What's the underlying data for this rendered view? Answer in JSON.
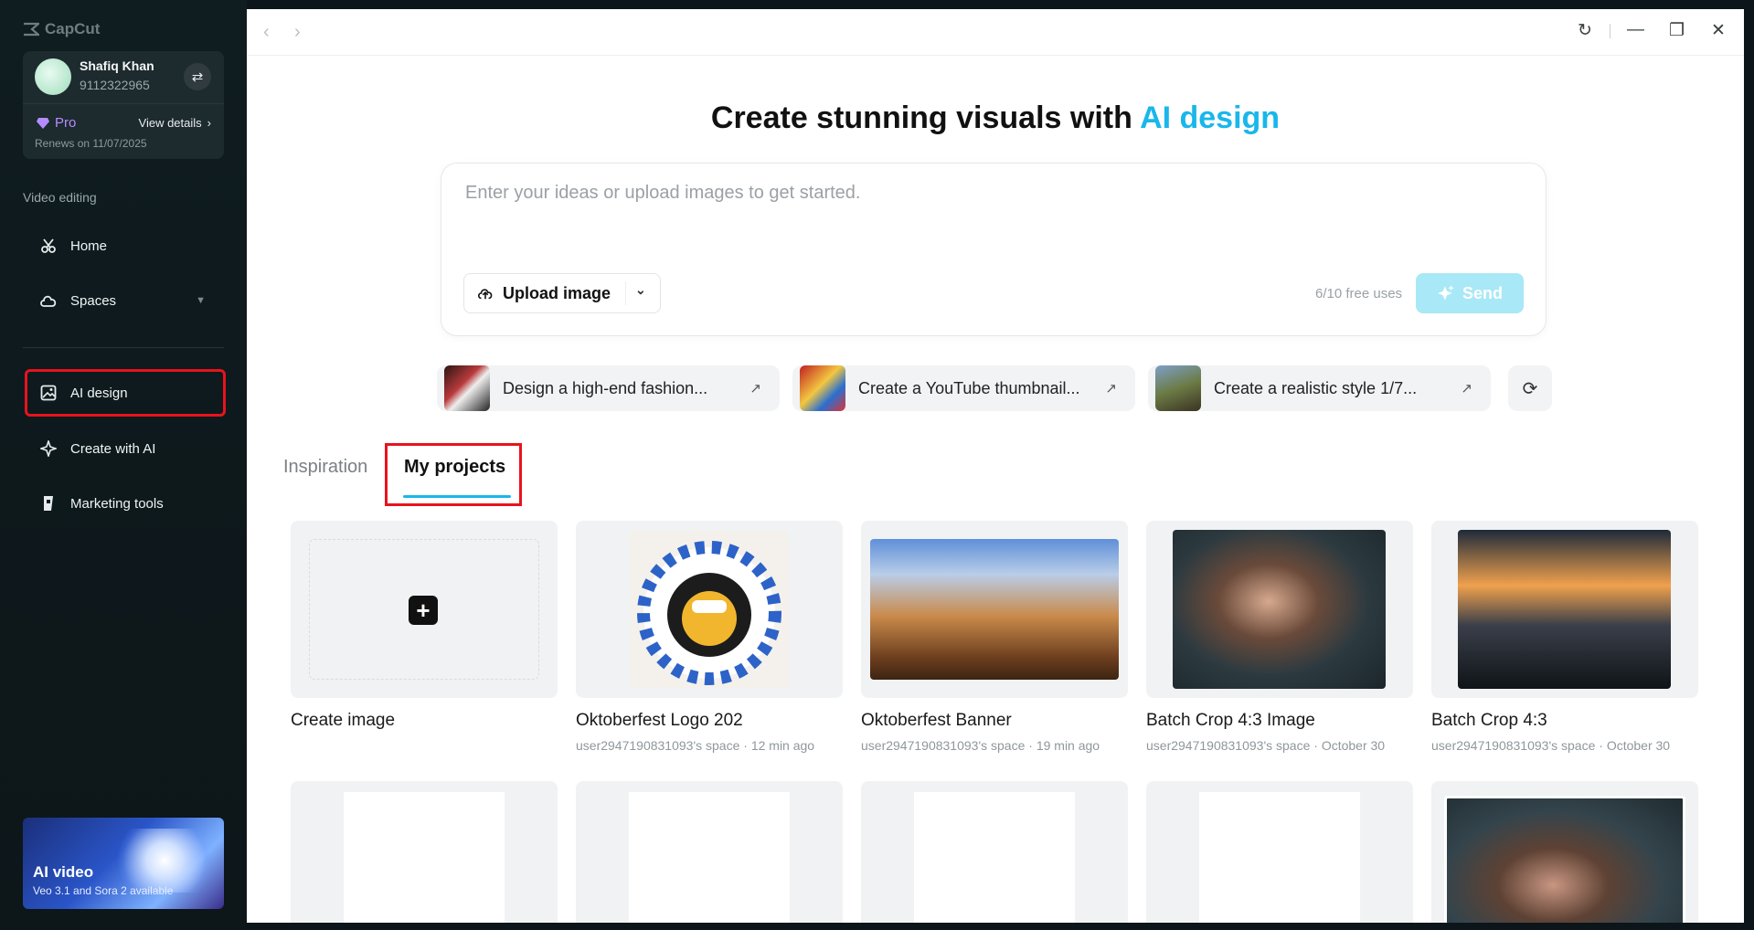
{
  "sidebar": {
    "brand": "CapCut",
    "user": {
      "name": "Shafiq Khan",
      "phone": "9112322965"
    },
    "plan": {
      "name": "Pro",
      "view_details": "View details",
      "renews": "Renews on 11/07/2025"
    },
    "section_label": "Video editing",
    "items": [
      {
        "label": "Home",
        "icon": "scissors-icon"
      },
      {
        "label": "Spaces",
        "icon": "cloud-icon"
      },
      {
        "label": "AI design",
        "icon": "ai-image-icon"
      },
      {
        "label": "Create with AI",
        "icon": "sparkle-icon"
      },
      {
        "label": "Marketing tools",
        "icon": "marketing-icon"
      }
    ],
    "promo": {
      "title": "AI video",
      "subtitle": "Veo 3.1 and Sora 2 available"
    }
  },
  "hero": {
    "title_prefix": "Create stunning visuals with ",
    "title_accent": "AI design",
    "placeholder": "Enter your ideas or upload images to get started.",
    "upload_label": "Upload image",
    "free_uses": "6/10 free uses",
    "send_label": "Send"
  },
  "suggestions": [
    {
      "label": "Design a high-end fashion..."
    },
    {
      "label": "Create a YouTube thumbnail..."
    },
    {
      "label": "Create a realistic style 1/7..."
    }
  ],
  "tabs": {
    "inspiration": "Inspiration",
    "my_projects": "My projects"
  },
  "projects": {
    "create_label": "Create image",
    "items": [
      {
        "title": "Oktoberfest Logo 202",
        "meta": "user2947190831093's space · 12 min ago"
      },
      {
        "title": "Oktoberfest Banner",
        "meta": "user2947190831093's space · 19 min ago"
      },
      {
        "title": "Batch Crop 4:3 Image",
        "meta": "user2947190831093's space · October 30"
      },
      {
        "title": "Batch Crop 4:3",
        "meta": "user2947190831093's space · October 30"
      }
    ]
  },
  "colors": {
    "accent": "#19b7ea",
    "highlight_box": "#e8131d",
    "send_bg": "#a9e8f6"
  }
}
